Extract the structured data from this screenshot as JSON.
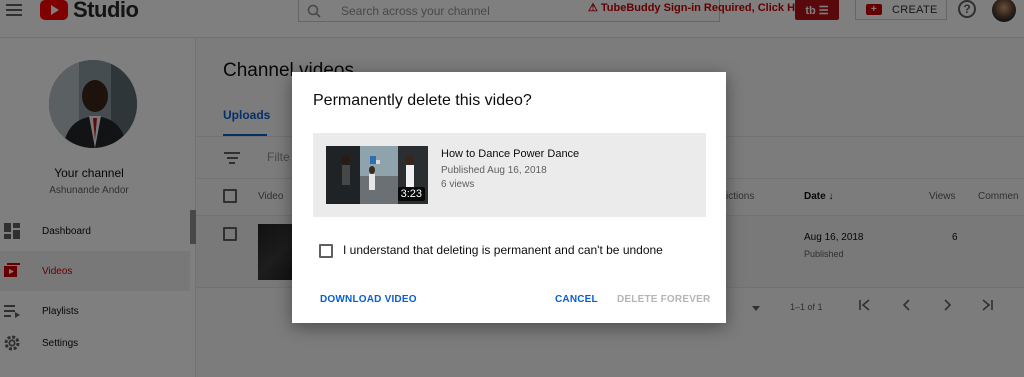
{
  "topbar": {
    "app_name": "Studio",
    "search_placeholder": "Search across your channel",
    "tubebuddy_warning": "TubeBuddy Sign-in Required, Click Here",
    "tubebuddy_button": "tb ☰",
    "create_label": "CREATE",
    "help_glyph": "?"
  },
  "sidebar": {
    "your_channel_label": "Your channel",
    "channel_name": "Ashunande Andor",
    "items": [
      {
        "label": "Dashboard",
        "icon": "dashboard-icon"
      },
      {
        "label": "Videos",
        "icon": "videos-icon",
        "active": true
      },
      {
        "label": "Playlists",
        "icon": "playlists-icon"
      },
      {
        "label": "Settings",
        "icon": "settings-icon"
      }
    ]
  },
  "main": {
    "page_title": "Channel videos",
    "tab_uploads": "Uploads",
    "filter_placeholder": "Filte",
    "columns": {
      "video": "Video",
      "restrictions": "ictions",
      "date": "Date ↓",
      "views": "Views",
      "comments": "Commen"
    },
    "row": {
      "date": "Aug 16, 2018",
      "status": "Published",
      "views": "6"
    },
    "pagination": {
      "range": "1–1 of 1"
    }
  },
  "dialog": {
    "title": "Permanently delete this video?",
    "video_title": "How to Dance Power Dance",
    "published": "Published Aug 16, 2018",
    "views": "6 views",
    "duration": "3:23",
    "acknowledge_text": "I understand that deleting is permanent and can't be undone",
    "download_label": "DOWNLOAD VIDEO",
    "cancel_label": "CANCEL",
    "delete_label": "DELETE FOREVER"
  },
  "colors": {
    "accent_blue": "#065fd4",
    "brand_red": "#ff0000",
    "warning_red": "#cc0000"
  }
}
